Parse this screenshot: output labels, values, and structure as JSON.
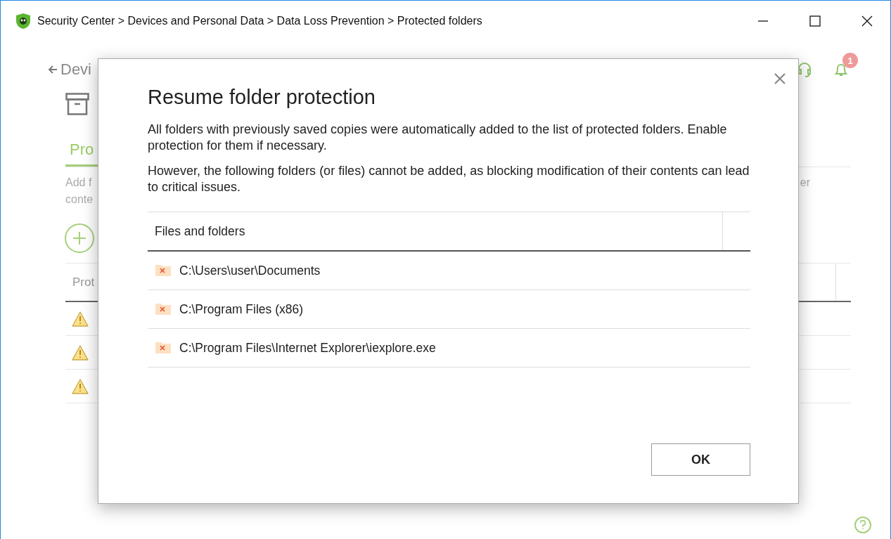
{
  "window": {
    "breadcrumb": "Security Center > Devices and Personal Data > Data Loss Prevention > Protected folders"
  },
  "background": {
    "back_link": "Devi",
    "tabs": [
      {
        "label": "Pro",
        "selected": true
      }
    ],
    "description": [
      "Add f",
      "conte"
    ],
    "description_right": "er",
    "table": {
      "column_1": "Prot",
      "rows": [
        {
          "kind": "warning"
        },
        {
          "kind": "warning"
        },
        {
          "kind": "warning"
        }
      ]
    },
    "notification_badge": "1"
  },
  "dialog": {
    "title": "Resume folder protection",
    "paragraphs": [
      "All folders with previously saved copies were automatically added to the list of protected folders. Enable protection for them if necessary.",
      "However, the following folders (or files) cannot be added, as blocking modification of their contents can lead to critical issues."
    ],
    "table": {
      "column_1": "Files and folders",
      "rows": [
        {
          "path": "C:\\Users\\user\\Documents",
          "kind": "blocked"
        },
        {
          "path": "C:\\Program Files (x86)",
          "kind": "blocked"
        },
        {
          "path": "C:\\Program Files\\Internet Explorer\\iexplore.exe",
          "kind": "blocked"
        }
      ]
    },
    "buttons": [
      "OK"
    ]
  }
}
